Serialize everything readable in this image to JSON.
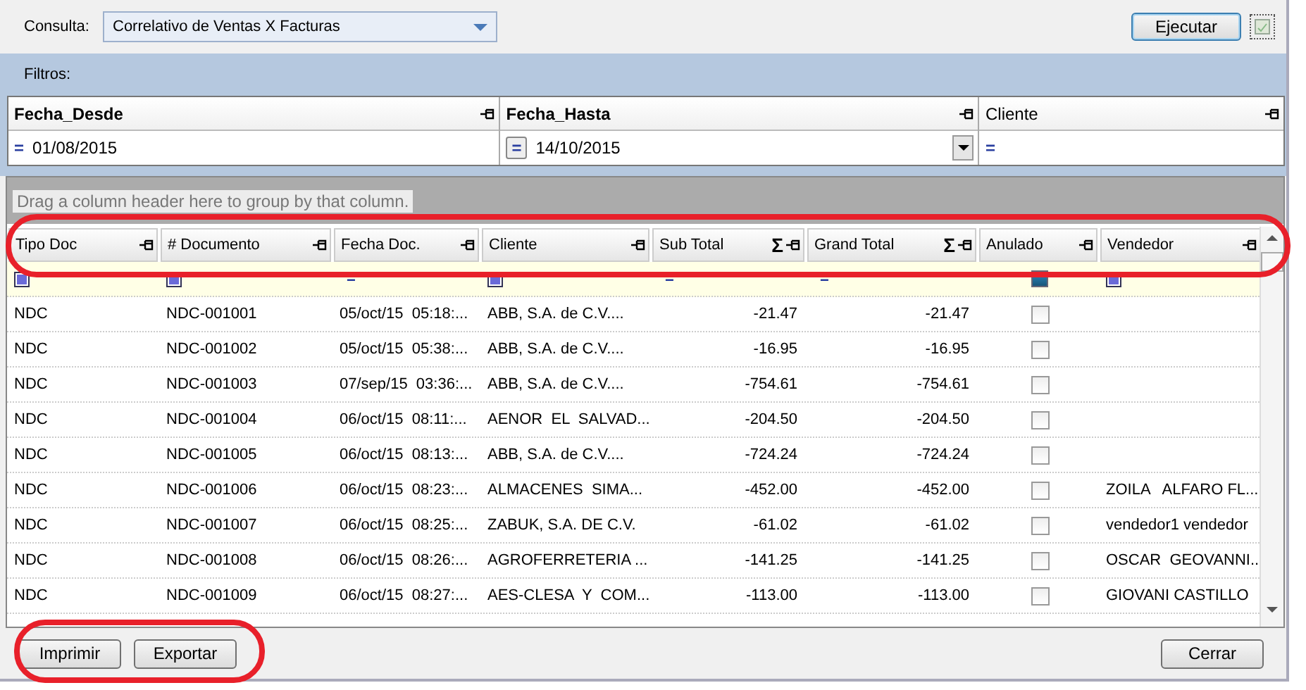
{
  "query": {
    "label": "Consulta:",
    "value": "Correlativo de Ventas X Facturas"
  },
  "run_button": "Ejecutar",
  "filters": {
    "title": "Filtros:",
    "fields": [
      {
        "label": "Fecha_Desde",
        "required": true,
        "operator": "=",
        "value": "01/08/2015",
        "kind": "plain"
      },
      {
        "label": "Fecha_Hasta",
        "required": true,
        "operator": "=",
        "value": "14/10/2015",
        "kind": "dropdown"
      },
      {
        "label": "Cliente",
        "required": false,
        "operator": "=",
        "kind": "plain"
      }
    ]
  },
  "grid": {
    "group_hint": "Drag a column header here to group by that column.",
    "columns": [
      {
        "label": "Tipo Doc",
        "kind": "text"
      },
      {
        "label": "# Documento",
        "kind": "text"
      },
      {
        "label": "Fecha Doc.",
        "kind": "text"
      },
      {
        "label": "Cliente",
        "kind": "text"
      },
      {
        "label": "Sub Total",
        "kind": "number",
        "sum_symbol": "Σ"
      },
      {
        "label": "Grand Total",
        "kind": "number",
        "sum_symbol": "Σ"
      },
      {
        "label": "Anulado",
        "kind": "check"
      },
      {
        "label": "Vendedor",
        "kind": "text"
      }
    ],
    "filter_row": [
      {
        "kind": "toggle"
      },
      {
        "kind": "toggle"
      },
      {
        "kind": "operator",
        "symbol": "="
      },
      {
        "kind": "toggle"
      },
      {
        "kind": "operator",
        "symbol": "="
      },
      {
        "kind": "operator",
        "symbol": "="
      },
      {
        "kind": "checkbox",
        "checked": true
      },
      {
        "kind": "toggle"
      }
    ],
    "rows": [
      {
        "cells": [
          "NDC",
          "NDC-001001",
          "05/oct/15  05:18:...",
          "ABB, S.A. de C.V....",
          "-21.47",
          "-21.47",
          false
        ]
      },
      {
        "cells": [
          "NDC",
          "NDC-001002",
          "05/oct/15  05:38:...",
          "ABB, S.A. de C.V....",
          "-16.95",
          "-16.95",
          false
        ]
      },
      {
        "cells": [
          "NDC",
          "NDC-001003",
          "07/sep/15  03:36:...",
          "ABB, S.A. de C.V....",
          "-754.61",
          "-754.61",
          false
        ]
      },
      {
        "cells": [
          "NDC",
          "NDC-001004",
          "06/oct/15  08:11:...",
          "AENOR  EL  SALVAD...",
          "-204.50",
          "-204.50",
          false
        ]
      },
      {
        "cells": [
          "NDC",
          "NDC-001005",
          "06/oct/15  08:13:...",
          "ABB, S.A. de C.V....",
          "-724.24",
          "-724.24",
          false
        ]
      },
      {
        "cells": [
          "NDC",
          "NDC-001006",
          "06/oct/15  08:23:...",
          "ALMACENES  SIMA...",
          "-452.00",
          "-452.00",
          false,
          "ZOILA   ALFARO FL..."
        ]
      },
      {
        "cells": [
          "NDC",
          "NDC-001007",
          "06/oct/15  08:25:...",
          "ZABUK, S.A. DE C.V.",
          "-61.02",
          "-61.02",
          false,
          "vendedor1 vendedor"
        ]
      },
      {
        "cells": [
          "NDC",
          "NDC-001008",
          "06/oct/15  08:26:...",
          "AGROFERRETERIA ...",
          "-141.25",
          "-141.25",
          false,
          "OSCAR  GEOVANNI..."
        ]
      },
      {
        "cells": [
          "NDC",
          "NDC-001009",
          "06/oct/15  08:27:...",
          "AES-CLESA  Y  COM...",
          "-113.00",
          "-113.00",
          false,
          "GIOVANI CASTILLO"
        ]
      }
    ]
  },
  "footer": {
    "left_buttons": [
      "Imprimir",
      "Exportar"
    ],
    "right_buttons": [
      "Cerrar"
    ]
  }
}
